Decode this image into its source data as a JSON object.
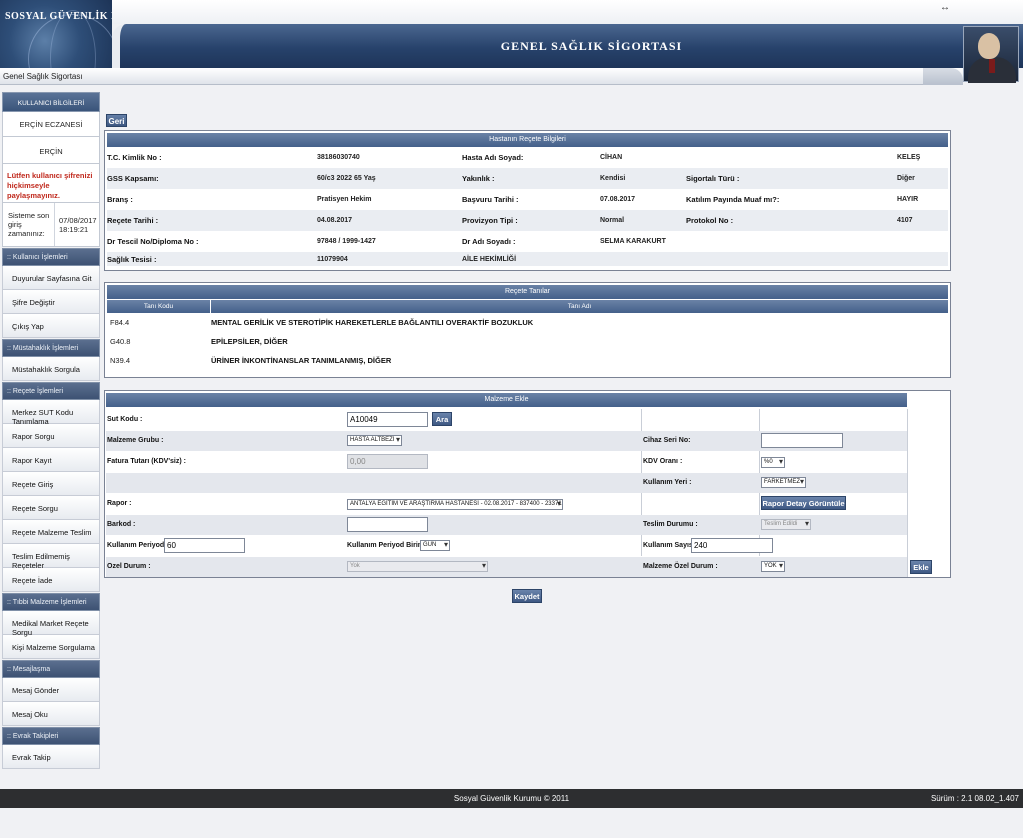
{
  "header": {
    "org_name": "SOSYAL GÜVENLİK KURUMU",
    "banner_title": "GENEL SAĞLIK SİGORTASI",
    "breadcrumb": "Genel Sağlık Sigortası",
    "resize_glyph": "↔"
  },
  "sidebar": {
    "user_info_title": "KULLANICI BİLGİLERİ",
    "pharmacy": "ERÇİN ECZANESİ",
    "user": "ERÇİN",
    "warning": "Lütfen kullanıcı şifrenizi hiçkimseyle paylaşmayınız.",
    "last_login_label": "Sisteme son giriş zamanınız:",
    "last_login_date": "07/08/2017",
    "last_login_time": "18:19:21",
    "sections": [
      {
        "title": ":: Kullanıcı İşlemleri",
        "items": [
          "Duyurular Sayfasına Git",
          "Şifre Değiştir",
          "Çıkış Yap"
        ]
      },
      {
        "title": ":: Müstahaklık İşlemleri",
        "items": [
          "Müstahaklık Sorgula"
        ]
      },
      {
        "title": ":: Reçete İşlemleri",
        "items": [
          "Merkez SUT Kodu Tanımlama",
          "Rapor Sorgu",
          "Rapor Kayıt",
          "Reçete Giriş",
          "Reçete Sorgu",
          "Reçete Malzeme Teslim",
          "Teslim Edilmemiş Reçeteler",
          "Reçete İade"
        ]
      },
      {
        "title": ":: Tıbbi Malzeme İşlemleri",
        "items": [
          "Medikal Market Reçete Sorgu",
          "Kişi Malzeme Sorgulama"
        ]
      },
      {
        "title": ":: Mesajlaşma",
        "items": [
          "Mesaj Gönder",
          "Mesaj Oku"
        ]
      },
      {
        "title": ":: Evrak Takipleri",
        "items": [
          "Evrak Takip"
        ]
      }
    ]
  },
  "main": {
    "back_button": "Geri",
    "patient": {
      "title": "Hastanın Reçete Bilgileri",
      "tc_label": "T.C. Kimlik No :",
      "tc_value": "38186030740",
      "name_label": "Hasta Adı Soyad:",
      "name_first": "CİHAN",
      "name_last": "KELEŞ",
      "gss_label": "GSS Kapsamı:",
      "gss_value": "60/c3 2022 65 Yaş",
      "relation_label": "Yakınlık :",
      "relation_value": "Kendisi",
      "insured_type_label": "Sigortalı Türü :",
      "insured_type_value": "Diğer",
      "branch_label": "Branş :",
      "branch_value": "Pratisyen Hekim",
      "apply_date_label": "Başvuru Tarihi :",
      "apply_date_value": "07.08.2017",
      "exempt_label": "Katılım Payında Muaf mı?:",
      "exempt_value": "HAYIR",
      "rx_date_label": "Reçete Tarihi :",
      "rx_date_value": "04.08.2017",
      "provision_label": "Provizyon Tipi :",
      "provision_value": "Normal",
      "protocol_label": "Protokol No :",
      "protocol_value": "4107",
      "doctor_reg_label": "Dr Tescil No/Diploma No :",
      "doctor_reg_value": "97848 / 1999-1427",
      "doctor_name_label": "Dr Adı Soyadı :",
      "doctor_name_value": "SELMA KARAKURT",
      "facility_label": "Sağlık Tesisi :",
      "facility_code": "11079904",
      "facility_name": "AİLE HEKİMLİĞİ"
    },
    "diagnoses": {
      "title": "Reçete Tanılar",
      "col_code": "Tanı Kodu",
      "col_name": "Tanı Adı",
      "rows": [
        {
          "code": "F84.4",
          "name": "MENTAL GERİLİK VE STEROTİPİK HAREKETLERLE BAĞLANTILI OVERAKTİF BOZUKLUK"
        },
        {
          "code": "G40.8",
          "name": "EPİLEPSİLER, DİĞER"
        },
        {
          "code": "N39.4",
          "name": "ÜRİNER İNKONTİNANSLAR TANIMLANMIŞ, DİĞER"
        }
      ]
    },
    "material": {
      "title": "Malzeme Ekle",
      "sut_label": "Sut Kodu :",
      "sut_value": "A10049",
      "search_button": "Ara",
      "group_label": "Malzeme Grubu :",
      "group_value": "HASTA ALTBEZİ",
      "device_serial_label": "Cihaz Seri No:",
      "device_serial_value": "",
      "invoice_label": "Fatura Tutarı (KDV'siz) :",
      "invoice_value": "0,00",
      "vat_label": "KDV Oranı :",
      "vat_value": "%0",
      "usage_place_label": "Kullanım Yeri :",
      "usage_place_value": "FARKETMEZ",
      "report_label": "Rapor :",
      "report_value": "ANTALYA EĞİTİM VE ARAŞTIRMA HASTANESİ - 02.08.2017 - 837400 - 233715015",
      "report_detail_button": "Rapor Detay Görüntüle",
      "barcode_label": "Barkod :",
      "barcode_value": "",
      "delivery_label": "Teslim Durumu :",
      "delivery_value": "Teslim Edildi",
      "period_label": "Kullanım Periyodu:",
      "period_value": "60",
      "period_unit_label": "Kullanım Periyod Birimi:",
      "period_unit_value": "GUN",
      "usage_count_label": "Kullanım Sayısı:",
      "usage_count_value": "240",
      "special_label": "Ozel Durum :",
      "special_value": "Yok",
      "material_special_label": "Malzeme Özel Durum :",
      "material_special_value": "YOK",
      "add_button": "Ekle"
    },
    "save_button": "Kaydet"
  },
  "footer": {
    "copyright": "Sosyal Güvenlik Kurumu © 2011",
    "version": "Sürüm : 2.1 08.02_1.407"
  }
}
